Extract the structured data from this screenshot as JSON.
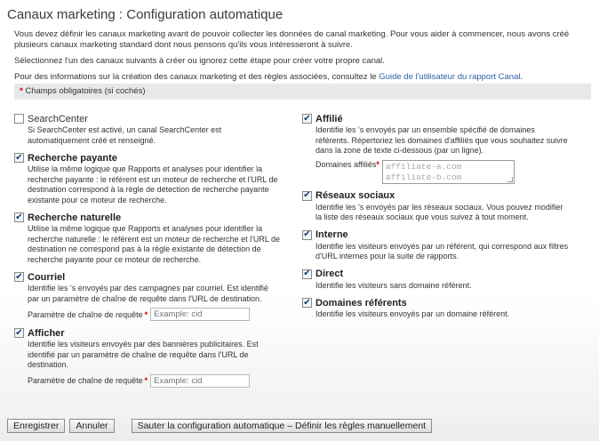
{
  "title": "Canaux marketing : Configuration automatique",
  "intro": {
    "line1": "Vous devez définir les canaux marketing avant de pouvoir collecter les données de canal marketing. Pour vous aider à commencer, nous avons créé plusieurs canaux marketing standard dont nous pensons qu'ils vous intéresseront à suivre.",
    "line2": "Sélectionnez l'un des canaux suivants à créer ou ignorez cette étape pour créer votre propre canal.",
    "line3_prefix": "Pour des informations sur la création des canaux marketing et des règles associées, consultez le ",
    "line3_link": "Guide de l'utilisateur du rapport Canal",
    "line3_suffix": "."
  },
  "required_note": {
    "star": "*",
    "text": " Champs obligatoires (si cochés)"
  },
  "left_channels": [
    {
      "checked": false,
      "title": "SearchCenter",
      "description": "Si SearchCenter est activé, un canal SearchCenter est automatiquement créé et renseigné."
    },
    {
      "checked": true,
      "title": "Recherche payante",
      "description": "Utilise la même logique que Rapports et analyses pour identifier la recherche payante : le référent est un moteur de recherche et l'URL de destination correspond à la règle de détection de recherche payante existante pour ce moteur de recherche."
    },
    {
      "checked": true,
      "title": "Recherche naturelle",
      "description": "Utilise la même logique que Rapports et analyses pour identifier la recherche naturelle : le référent est un moteur de recherche et l'URL de destination ne correspond pas à la règle existante de détection de recherche payante pour ce moteur de recherche."
    },
    {
      "checked": true,
      "title": "Courriel",
      "description": "Identifie les 's envoyés par des campagnes par courriel. Est identifié par un paramètre de chaîne de requête dans l'URL de destination.",
      "field_label": "Paramètre de chaîne de requête",
      "field_star": "*",
      "field_placeholder": "Example: cid"
    },
    {
      "checked": true,
      "title": "Afficher",
      "description": "Identifie les visiteurs envoyés par des bannières publicitaires. Est identifié par un paramètre de chaîne de requête dans l'URL de destination.",
      "field_label": "Paramètre de chaîne de requête",
      "field_star": "*",
      "field_placeholder": "Example: cid"
    }
  ],
  "right_channels": [
    {
      "checked": true,
      "title": "Affilié",
      "description": "Identifie les 's envoyés par un ensemble spécifié de domaines référents. Répertoriez les domaines d'affiliés que vous souhaitez suivre dans la zone de texte ci-dessous (par un ligne).",
      "field_label": "Domaines affiliés",
      "field_star": "*",
      "textarea_lines": [
        "affiliate-a.com",
        "affiliate-b.com"
      ]
    },
    {
      "checked": true,
      "title": "Réseaux sociaux",
      "description": "Identifie les 's envoyés par les réseaux sociaux. Vous pouvez modifier la liste des réseaux sociaux que vous suivez à tout moment."
    },
    {
      "checked": true,
      "title": "Interne",
      "description": "Identifie les visiteurs envoyés par un référent, qui correspond aux filtres d'URL internes pour la suite de rapports."
    },
    {
      "checked": true,
      "title": "Direct",
      "description": "Identifie les visiteurs sans domaine référent."
    },
    {
      "checked": true,
      "title": "Domaines référents",
      "description": "Identifie les visiteurs envoyés par un domaine référent."
    }
  ],
  "buttons": {
    "save": "Enregistrer",
    "cancel": "Annuler",
    "skip": "Sauter la configuration automatique – Définir les règles manuellement"
  },
  "colors": {
    "link": "#2f5fa8",
    "required_star": "#cc0000"
  }
}
